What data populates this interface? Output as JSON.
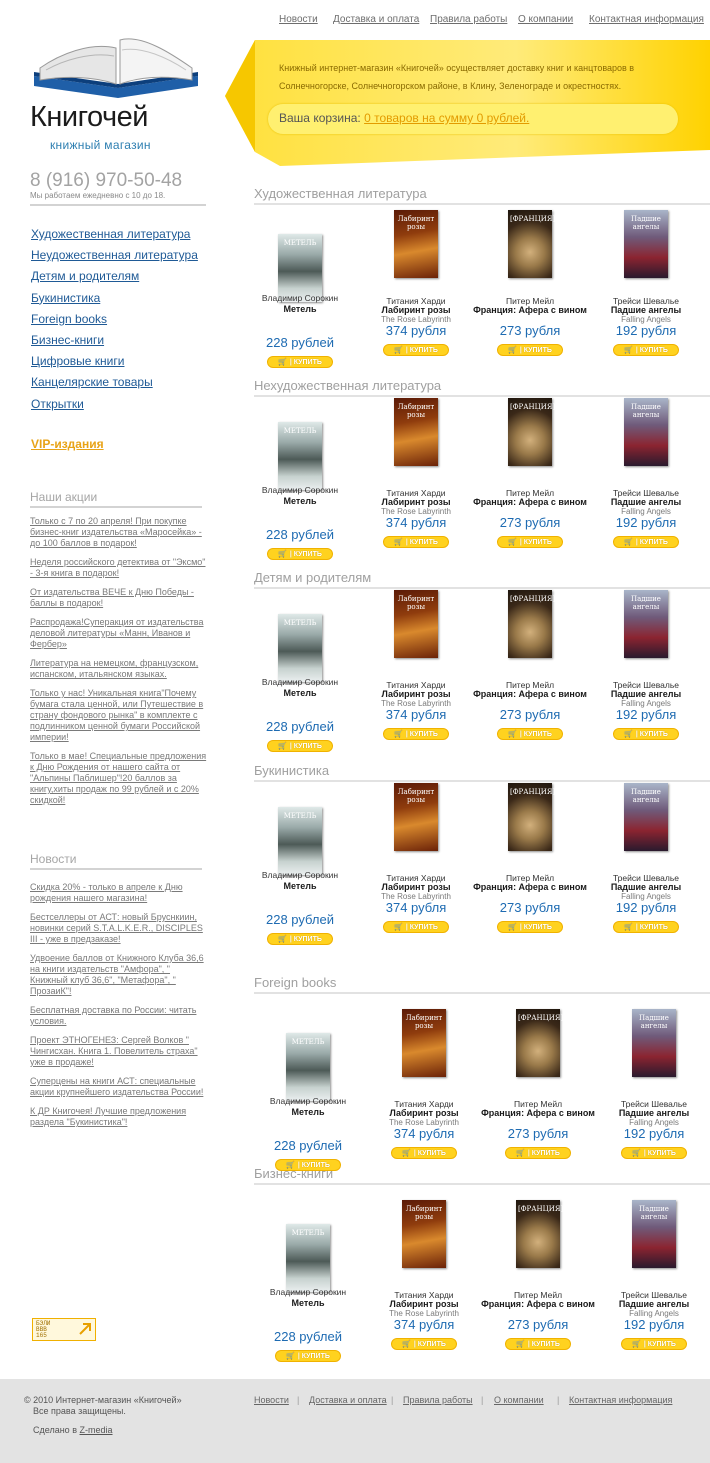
{
  "top_nav": [
    "Новости",
    "Доставка и оплата",
    "Правила работы",
    "О компании",
    "Контактная информация"
  ],
  "brand": {
    "name": "Книгочей",
    "tagline": "книжный магазин",
    "phone": "8 (916) 970-50-48",
    "hours": "Мы работаем ежедневно с 10 до 18."
  },
  "banner": {
    "text": "Книжный интернет-магазин «Книгочей» осуществляет доставку книг и канцтоваров в Солнечногорске, Солнечногорском районе, в Клину, Зеленограде и окрестностях.",
    "cart_label": "Ваша корзина:",
    "cart_link": "0 товаров на сумму 0 рублей."
  },
  "side_menu": [
    "Художественная литература",
    "Неудожественная литература",
    "Детям и родителям",
    "Букинистика",
    "Foreign books",
    "Бизнес-книги",
    "Цифровые книги",
    "Канцелярские товары",
    "Открытки"
  ],
  "vip": "VIP-издания",
  "promos": {
    "title": "Наши акции",
    "items": [
      "Только с 7 по 20 апреля! При покупке бизнес-книг издательства «Маросейка» - до 100 баллов в подарок!",
      "Неделя российского детектива от \"Эксмо\" - 3-я книга в подарок!",
      "От издательства ВЕЧЕ к Дню Победы - баллы в подарок!",
      "Распродажа!Суперакция от издательства деловой литературы «Манн, Иванов и Фербер»",
      "Литература на немецком, французском, испанском, итальянском языках.",
      "Только у нас! Уникальная книга\"Почему бумага стала ценной, или Путешествие в страну фондового рынка\" в комплекте с подлинником ценной бумаги Российской империи!",
      "Только в мае! Специальные предложения к Дню Рождения от нашего сайта от \"Альпины Паблишер\"!20 баллов за книгу,хиты продаж по 99 рублей и с 20% скидкой!"
    ]
  },
  "news": {
    "title": "Новости",
    "items": [
      "Скидка 20% - только в апреле к Дню рождения нашего магазина!",
      "Бестселлеры от АСТ: новый Бруснкиин, новинки серий S.T.A.L.K.E.R., DISCIPLES III - уже в предзаказе!",
      "Удвоение баллов от Книжного Клуба 36,6 на книги издательств \"Амфора\", \" Книжный клуб 36,6\", \"Метафора\", \" ПрозаиК\"!",
      "Бесплатная доставка по России: читать условия.",
      "Проект ЭТНОГЕНЕЗ: Сергей Волков \" Чингисхан. Книга 1. Повелитель страха\" уже в продаже!",
      "Суперцены на книги АСТ: специальные акции крупнейшего издательства России!",
      "К ДР Книгочея! Лучшие предложения раздела \"Букинистика\"!"
    ]
  },
  "counter": [
    "БЭЛИ",
    "ВВВ",
    "165"
  ],
  "sections": [
    "Художественная литература",
    "Нехудожественная литература",
    "Детям и родителям",
    "Букинистика",
    "Foreign books",
    "Бизнес-книги"
  ],
  "products": [
    {
      "author": "Владимир Сорокин",
      "title": "Метель",
      "orig": "",
      "price": "228 рублей",
      "cover": "metel",
      "cover_text": "МЕТЕЛЬ"
    },
    {
      "author": "Титания Харди",
      "title": "Лабиринт розы",
      "orig": "The Rose Labyrinth",
      "price": "374 рубля",
      "cover": "rose",
      "cover_text": "Лабиринт розы"
    },
    {
      "author": "Питер Мейл",
      "title": "Франция: Афера с вином",
      "orig": "",
      "price": "273 рубля",
      "cover": "france",
      "cover_text": "[ФРАНЦИЯ]"
    },
    {
      "author": "Трейси Шевалье",
      "title": "Падшие ангелы",
      "orig": "Falling Angels",
      "price": "192 рубля",
      "cover": "angels",
      "cover_text": "Падшие ангелы"
    }
  ],
  "buy_label": "| КУПИТЬ",
  "footer": {
    "copyright": "© 2010 Интернет-магазин «Книгочей»",
    "rights": "Все права защищены.",
    "made_prefix": "Сделано в",
    "made_link": "Z-media",
    "nav": [
      "Новости",
      "Доставка и оплата",
      "Правила работы",
      "О компании",
      "Контактная информация"
    ]
  },
  "colors": {
    "accent": "#ffd21f",
    "link": "#1f5a96",
    "price": "#1e6bb2",
    "vip": "#e8a317"
  }
}
